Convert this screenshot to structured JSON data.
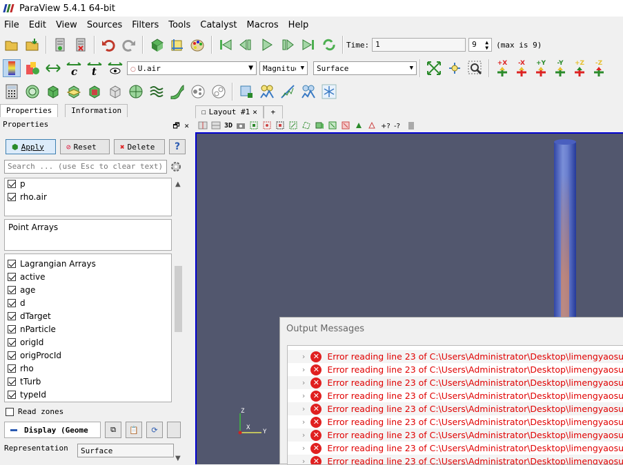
{
  "app": {
    "title": "ParaView 5.4.1 64-bit"
  },
  "menu": [
    "File",
    "Edit",
    "View",
    "Sources",
    "Filters",
    "Tools",
    "Catalyst",
    "Macros",
    "Help"
  ],
  "time": {
    "label": "Time:",
    "value": "1",
    "step": "9",
    "max_label": "(max is 9)"
  },
  "toolbar2": {
    "array": "U.air",
    "component": "Magnitude",
    "representation": "Surface",
    "camera_labels": [
      "+X",
      "-X",
      "+Y",
      "-Y",
      "+Z",
      "-Z"
    ]
  },
  "left": {
    "tabs": [
      "Properties",
      "Information"
    ],
    "panel_title": "Properties",
    "apply": "Apply",
    "reset": "Reset",
    "delete": "Delete",
    "help": "?",
    "search_placeholder": "Search ... (use Esc to clear text)",
    "cell_arrays": [
      "p",
      "rho.air"
    ],
    "point_arrays_title": "Point Arrays",
    "lagrangian_title": "Lagrangian Arrays",
    "lagrangian": [
      "active",
      "age",
      "d",
      "dTarget",
      "nParticle",
      "origId",
      "origProcId",
      "rho",
      "tTurb",
      "typeId"
    ],
    "read_zones": "Read zones",
    "display_label": "Display (Geome",
    "representation_label": "Representation",
    "representation_value": "Surface"
  },
  "layout": {
    "tab": "Layout #1",
    "add": "+",
    "threed": "3D"
  },
  "axes": {
    "z": "Z",
    "x": "X",
    "y": "Y"
  },
  "messages": {
    "title": "Output Messages",
    "items": [
      "Error reading line 23 of C:\\Users\\Administrator\\Desktop\\limengyaosu",
      "Error reading line 23 of C:\\Users\\Administrator\\Desktop\\limengyaosu",
      "Error reading line 23 of C:\\Users\\Administrator\\Desktop\\limengyaosu",
      "Error reading line 23 of C:\\Users\\Administrator\\Desktop\\limengyaosu",
      "Error reading line 23 of C:\\Users\\Administrator\\Desktop\\limengyaosu",
      "Error reading line 23 of C:\\Users\\Administrator\\Desktop\\limengyaosu",
      "Error reading line 23 of C:\\Users\\Administrator\\Desktop\\limengyaosu",
      "Error reading line 23 of C:\\Users\\Administrator\\Desktop\\limengyaosu",
      "Error reading line 23 of C:\\Users\\Administrator\\Desktop\\limengyaosu"
    ]
  }
}
